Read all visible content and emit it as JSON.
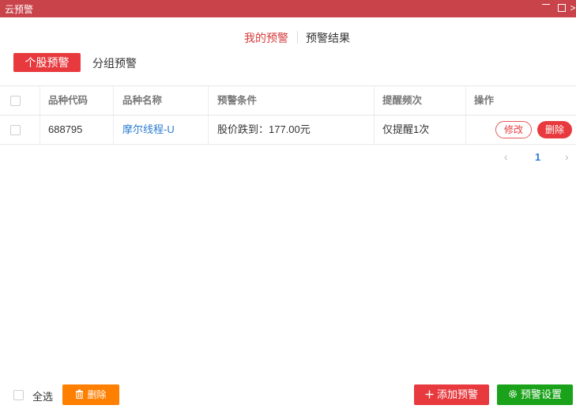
{
  "window": {
    "title": "云预警",
    "min_symbol": "—",
    "max_symbol": "□",
    "close_symbol": ">"
  },
  "topnav": {
    "tabs": [
      {
        "label": "我的预警",
        "active": true
      },
      {
        "label": "预警结果",
        "active": false
      }
    ]
  },
  "subtabs": [
    {
      "label": "个股预警",
      "active": true
    },
    {
      "label": "分组预警",
      "active": false
    }
  ],
  "table": {
    "headers": [
      "品种代码",
      "品种名称",
      "预警条件",
      "提醒频次",
      "操作"
    ],
    "rows": [
      {
        "code": "688795",
        "name": "摩尔线程-U",
        "condition": "股价跌到：177.00元",
        "frequency": "仅提醒1次",
        "edit_label": "修改",
        "delete_label": "删除"
      }
    ]
  },
  "pager": {
    "prev": "‹",
    "page": "1",
    "next": "›"
  },
  "footer": {
    "select_all": "全选",
    "delete_label": "删除",
    "delete_icon": "trash-icon",
    "add_label": "添加预警",
    "add_icon": "plus-icon",
    "settings_label": "预警设置",
    "settings_icon": "gear-icon"
  },
  "colors": {
    "titlebar": "#c9434a",
    "accent_red": "#e83a3e",
    "orange": "#ff7f00",
    "green": "#1aa31a",
    "link_blue": "#2b7cd3"
  }
}
